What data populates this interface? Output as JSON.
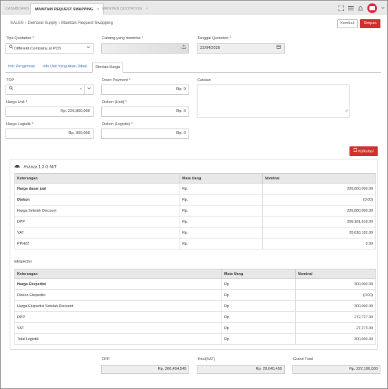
{
  "tabs": [
    {
      "label": "DASHBOARD"
    },
    {
      "label": "MAINTAIN REQUEST SWAPPING"
    },
    {
      "label": "MAINTAIN QUOTATION"
    }
  ],
  "close_glyph": "×",
  "breadcrumb": [
    "SALES",
    "Demand Supply",
    "Maintain Request Swapping"
  ],
  "buttons": {
    "back": "Kembali",
    "save": "Simpan",
    "calc": "Kalkulasi"
  },
  "form": {
    "tipe_quotation_label": "Tipe Quotation",
    "tipe_quotation_value": "Different Company at PDS",
    "cabang_label": "Cabang yang meminta",
    "cabang_value": "",
    "tanggal_label": "Tanggal Quotation",
    "tanggal_value": "22/04/2020"
  },
  "sub_tabs": [
    {
      "label": "Info Pengiriman"
    },
    {
      "label": "Info Unit Yang Akan Dibeli"
    },
    {
      "label": "Rincian Harga"
    }
  ],
  "rincian": {
    "top_label": "TOP",
    "top_value": "",
    "down_payment_label": "Down Payment",
    "down_payment_value": "Rp. 0",
    "catatan_label": "Catatan",
    "harga_unit_label": "Harga Unit",
    "harga_unit_value": "Rp. 226,800,000",
    "diskon_unit_label": "Diskon (Unit)",
    "diskon_unit_value": "Rp. 0",
    "harga_logistik_label": "Harga Logistik",
    "harga_logistik_value": "Rp. 300,000",
    "diskon_logistic_label": "Diskon (Logistic)",
    "diskon_logistic_value": "Rp. 0"
  },
  "vehicle": "Avanza 1.3 G M/T",
  "table1": {
    "headers": [
      "Keterangan",
      "Mata Uang",
      "Nominal"
    ],
    "rows": [
      {
        "k": "Harga dasar jual",
        "m": "Rp.",
        "n": "226,800,000.00",
        "bold": true
      },
      {
        "k": "Diskon",
        "m": "Rp.",
        "n": "(0.00)",
        "bold": true
      },
      {
        "k": "Harga Setelah Discount",
        "m": "Rp.",
        "n": "226,800,000.00",
        "bold": false
      },
      {
        "k": "DPP",
        "m": "Rp.",
        "n": "206,181,818.00",
        "bold": false
      },
      {
        "k": "VAT",
        "m": "Rp.",
        "n": "20,618,182.00",
        "bold": false
      },
      {
        "k": "PPH22",
        "m": "Rp.",
        "n": "0.00",
        "bold": false
      }
    ]
  },
  "ekspedisi_title": "Ekspedisi",
  "table2": {
    "headers": [
      "Keterangan",
      "Mata Uang",
      "Nominal"
    ],
    "rows": [
      {
        "k": "Harga Ekspedisi",
        "m": "Rp",
        "n": "300,000.00",
        "bold": true
      },
      {
        "k": "Diskon Ekspedisi",
        "m": "Rp",
        "n": "(0.00)",
        "bold": false
      },
      {
        "k": "Harga Ekspedisi Setelah Discount",
        "m": "Rp",
        "n": "300,000.00",
        "bold": false
      },
      {
        "k": "DPP",
        "m": "Rp",
        "n": "272,727.00",
        "bold": false
      },
      {
        "k": "VAT",
        "m": "Rp",
        "n": "27,273.00",
        "bold": false
      },
      {
        "k": "Total Logistik",
        "m": "Rp",
        "n": "300,000.00",
        "bold": false
      }
    ]
  },
  "summary": {
    "dpp_label": "DPP",
    "dpp_value": "Rp. 206,454,545",
    "vat_label": "Total(VAT)",
    "vat_value": "Rp. 20,645,455",
    "grand_label": "Grand Total",
    "grand_value": "Rp. 227,100,000"
  },
  "colors": {
    "accent": "#d32f2f",
    "link": "#3b6fb6"
  }
}
